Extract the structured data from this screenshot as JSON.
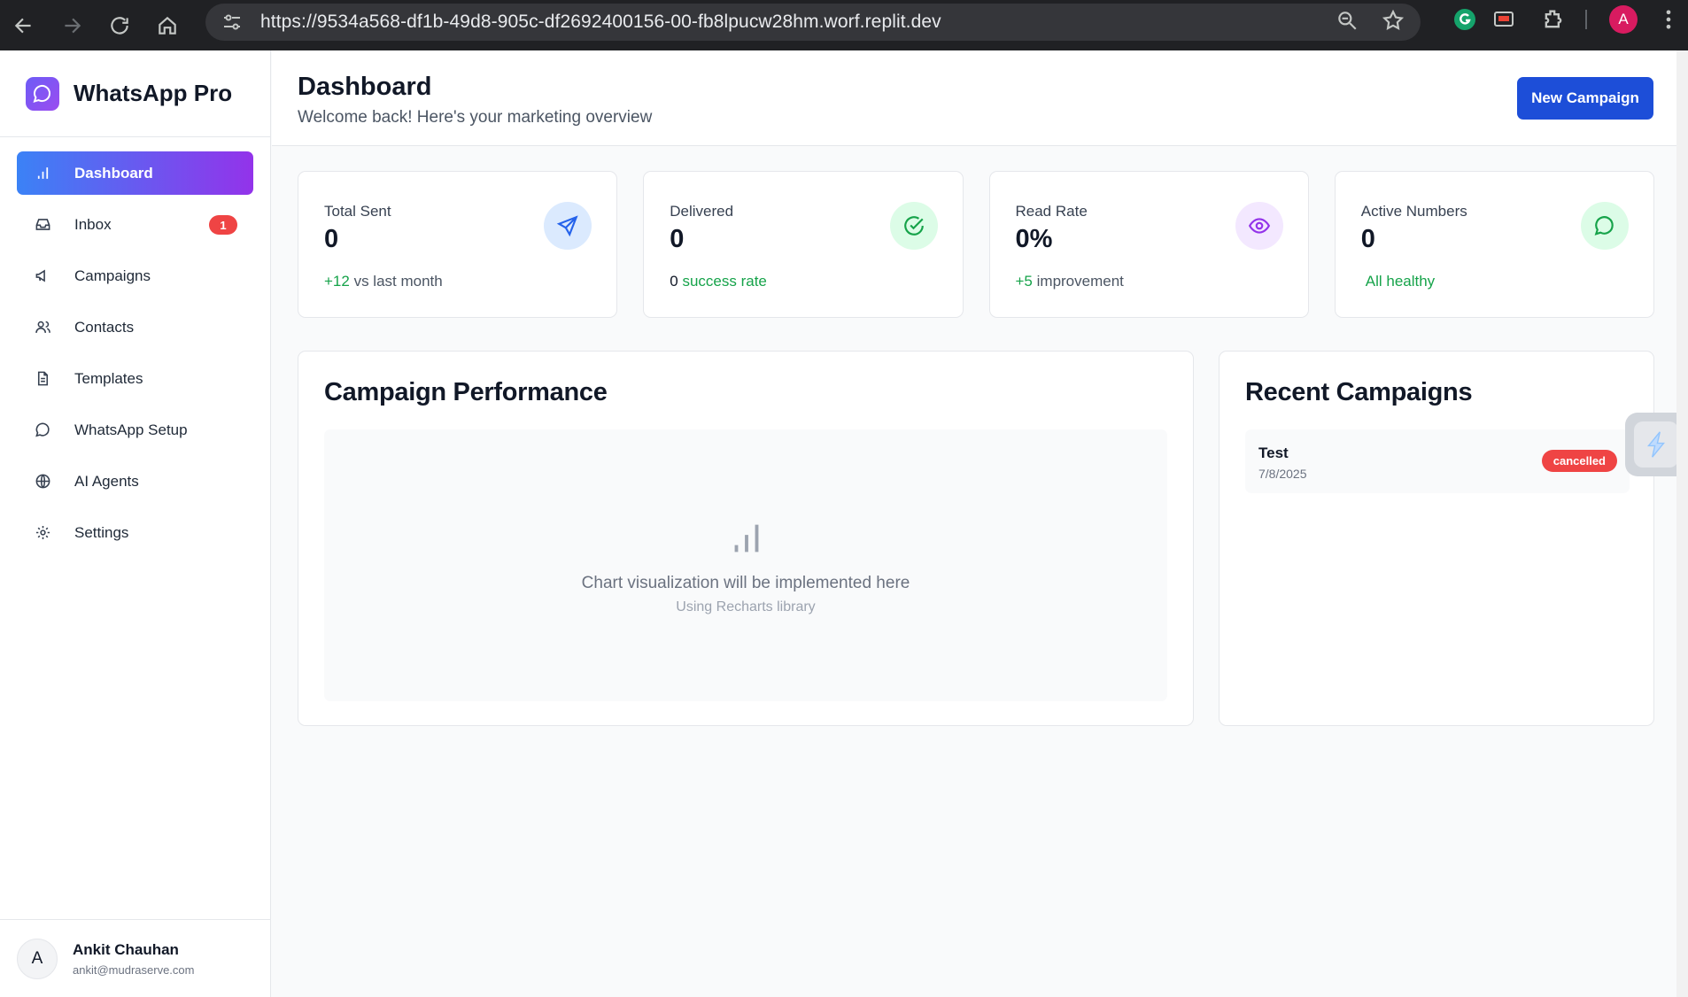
{
  "browser": {
    "url": "https://9534a568-df1b-49d8-905c-df2692400156-00-fb8lpucw28hm.worf.replit.dev",
    "profile_initial": "A"
  },
  "sidebar": {
    "brand": "WhatsApp Pro",
    "items": [
      {
        "label": "Dashboard",
        "icon": "bar-chart-icon",
        "active": true
      },
      {
        "label": "Inbox",
        "icon": "inbox-icon",
        "badge": "1"
      },
      {
        "label": "Campaigns",
        "icon": "megaphone-icon"
      },
      {
        "label": "Contacts",
        "icon": "users-icon"
      },
      {
        "label": "Templates",
        "icon": "file-text-icon"
      },
      {
        "label": "WhatsApp Setup",
        "icon": "message-circle-icon"
      },
      {
        "label": "AI Agents",
        "icon": "globe-icon"
      },
      {
        "label": "Settings",
        "icon": "gear-icon"
      }
    ],
    "user": {
      "initial": "A",
      "name": "Ankit Chauhan",
      "email": "ankit@mudraserve.com"
    }
  },
  "header": {
    "title": "Dashboard",
    "subtitle": "Welcome back! Here's your marketing overview",
    "new_campaign_label": "New Campaign"
  },
  "stats": [
    {
      "title": "Total Sent",
      "value": "0",
      "foot_highlight": "+12",
      "foot_text": "vs last month",
      "icon": "send-icon",
      "icon_bg": "#dbeafe",
      "icon_color": "#2563eb"
    },
    {
      "title": "Delivered",
      "value": "0",
      "foot_highlight": "0",
      "foot_text": "success rate",
      "icon": "check-circle-icon",
      "icon_bg": "#dcfce7",
      "icon_color": "#16a34a"
    },
    {
      "title": "Read Rate",
      "value": "0%",
      "foot_highlight": "+5",
      "foot_text": "improvement",
      "icon": "eye-icon",
      "icon_bg": "#f3e8ff",
      "icon_color": "#9333ea"
    },
    {
      "title": "Active Numbers",
      "value": "0",
      "foot_text": "All healthy",
      "icon": "message-circle-icon",
      "icon_bg": "#dcfce7",
      "icon_color": "#16a34a"
    }
  ],
  "performance": {
    "title": "Campaign Performance",
    "placeholder_main": "Chart visualization will be implemented here",
    "placeholder_sub": "Using Recharts library"
  },
  "recent": {
    "title": "Recent Campaigns",
    "campaigns": [
      {
        "name": "Test",
        "date": "7/8/2025",
        "status": "cancelled"
      }
    ]
  }
}
